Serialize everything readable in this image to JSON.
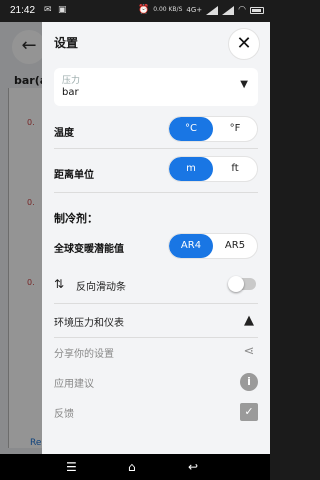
{
  "status_bar": {
    "time": "21:42",
    "speed": "0.00 KB/S",
    "network": "4G+",
    "wifi_label": "4G"
  },
  "background": {
    "back_icon": "arrow-left-icon",
    "label": "bar(a",
    "ticks": [
      "0.",
      "0.",
      "0."
    ],
    "link": "Re"
  },
  "drawer": {
    "title": "设置",
    "close_icon": "close-icon",
    "pressure": {
      "label": "压力",
      "value": "bar"
    },
    "temperature": {
      "label": "温度",
      "options": [
        "°C",
        "°F"
      ],
      "selected": "°C"
    },
    "distance": {
      "label": "距离单位",
      "options": [
        "m",
        "ft"
      ],
      "selected": "m"
    },
    "refrigerant_section": "制冷剂：",
    "gwp": {
      "label": "全球变暖潜能值",
      "options": [
        "AR4",
        "AR5"
      ],
      "selected": "AR4"
    },
    "reverse_slider": {
      "label": "反向滑动条",
      "enabled": false
    },
    "env": {
      "label": "环境压力和仪表",
      "icon": "mountain-icon"
    },
    "share": {
      "label": "分享你的设置",
      "icon": "share-icon"
    },
    "suggest": {
      "label": "应用建议",
      "icon": "info-icon"
    },
    "feedback": {
      "label": "反馈",
      "icon": "checklist-icon"
    }
  },
  "colors": {
    "accent": "#1976e4"
  }
}
